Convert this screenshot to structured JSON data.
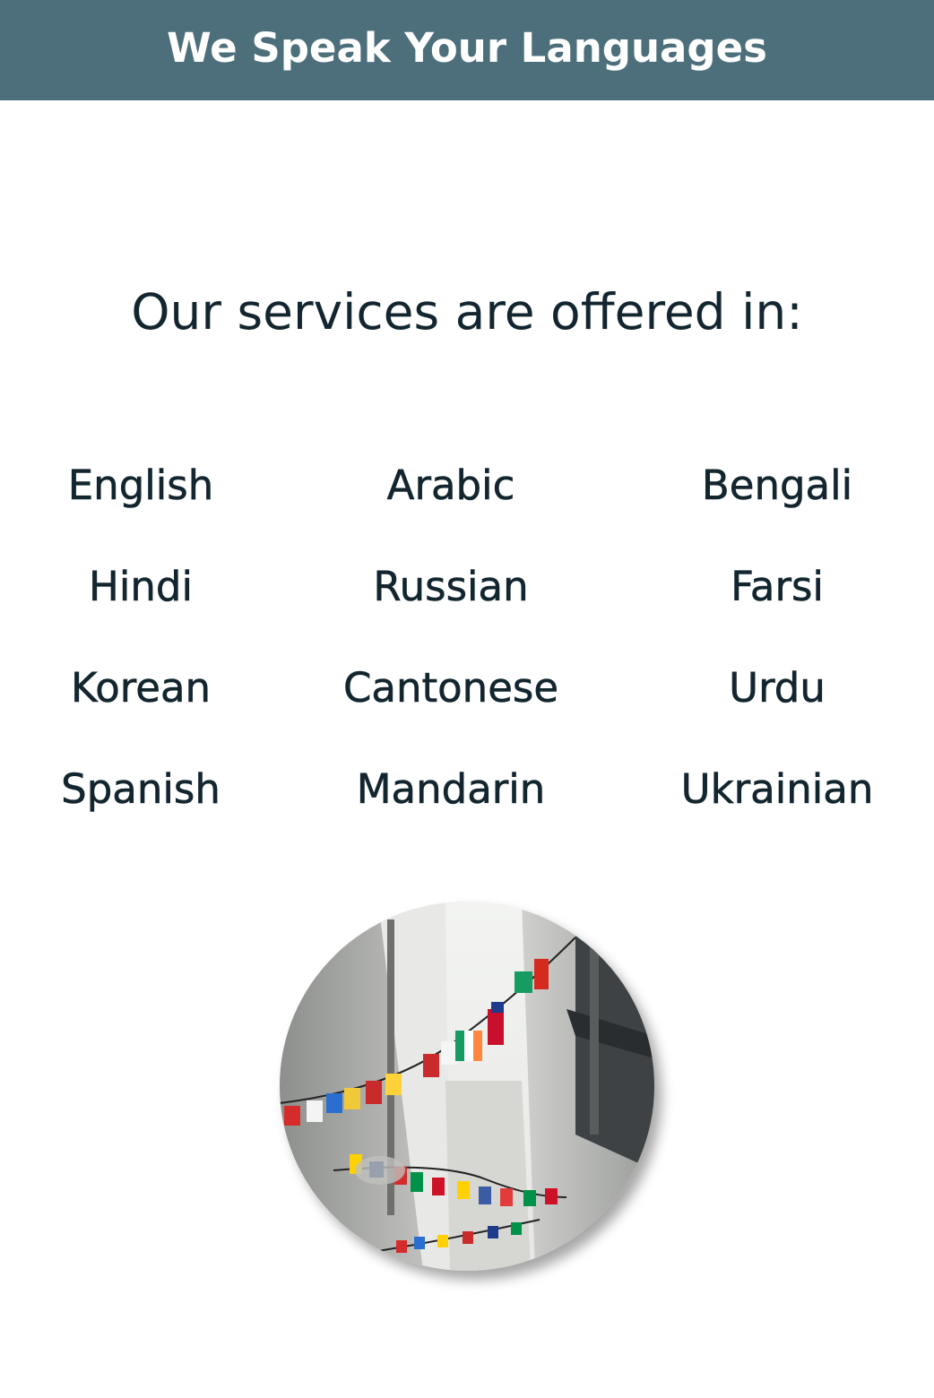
{
  "header": {
    "title": "We Speak Your Languages"
  },
  "main": {
    "subtitle": "Our services are offered in:",
    "languages": [
      [
        "English",
        "Arabic",
        "Bengali"
      ],
      [
        "Hindi",
        "Russian",
        "Farsi"
      ],
      [
        "Korean",
        "Cantonese",
        "Urdu"
      ],
      [
        "Spanish",
        "Mandarin",
        "Ukrainian"
      ]
    ]
  },
  "colors": {
    "header_bg": "#4d6f7b",
    "text": "#13262f"
  }
}
